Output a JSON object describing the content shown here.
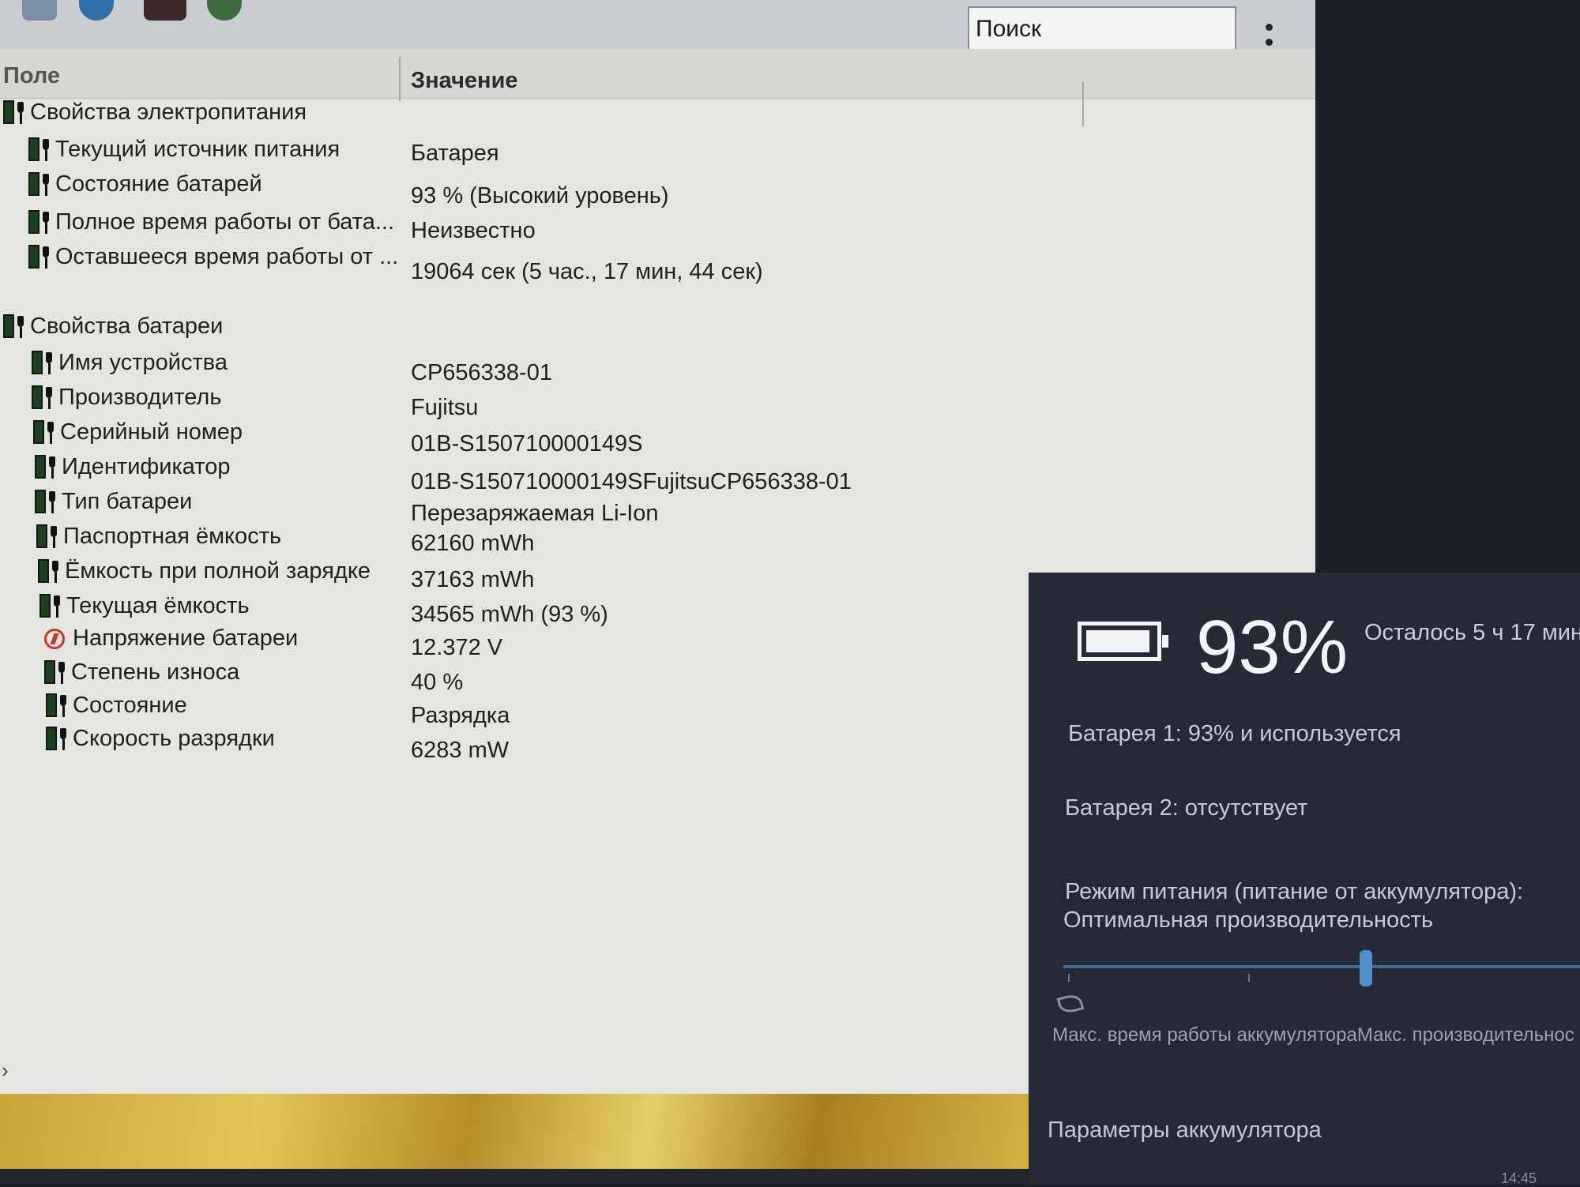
{
  "toolbar": {
    "search_value": "Поиск"
  },
  "columns": {
    "field": "Поле",
    "value": "Значение"
  },
  "power": {
    "title": "Свойства электропитания",
    "rows": [
      {
        "field": "Текущий источник питания",
        "value": "Батарея"
      },
      {
        "field": "Состояние батарей",
        "value": "93 % (Высокий уровень)"
      },
      {
        "field": "Полное время работы от бата...",
        "value": "Неизвестно"
      },
      {
        "field": "Оставшееся время работы от ...",
        "value": "19064 сек (5 час., 17 мин, 44 сек)"
      }
    ]
  },
  "battery": {
    "title": "Свойства батареи",
    "rows": [
      {
        "field": "Имя устройства",
        "value": "CP656338-01"
      },
      {
        "field": "Производитель",
        "value": "Fujitsu"
      },
      {
        "field": "Серийный номер",
        "value": "01B-S150710000149S"
      },
      {
        "field": "Идентификатор",
        "value": "01B-S150710000149SFujitsuCP656338-01"
      },
      {
        "field": "Тип батареи",
        "value": "Перезаряжаемая Li-Ion"
      },
      {
        "field": "Паспортная ёмкость",
        "value": "62160 mWh"
      },
      {
        "field": "Ёмкость при полной зарядке",
        "value": "37163 mWh"
      },
      {
        "field": "Текущая ёмкость",
        "value": "34565 mWh  (93 %)"
      },
      {
        "field": "Напряжение батареи",
        "value": "12.372 V"
      },
      {
        "field": "Степень износа",
        "value": "40 %"
      },
      {
        "field": "Состояние",
        "value": "Разрядка"
      },
      {
        "field": "Скорость разрядки",
        "value": "6283 mW"
      }
    ]
  },
  "flyout": {
    "percent": "93%",
    "remaining": "Осталось 5 ч 17 мин",
    "battery1": "Батарея 1: 93% и используется",
    "battery2": "Батарея 2: отсутствует",
    "mode_line1": "Режим питания (питание от аккумулятора):",
    "mode_line2": "Оптимальная производительность",
    "slider_min_label": "Макс. время работы аккумулятора",
    "slider_max_label": "Макс. производительнос",
    "slider_level": 0.67,
    "settings_link": "Параметры аккумулятора",
    "clock": "14:45"
  },
  "colors": {
    "window_bg": "#e4e5e0",
    "flyout_bg": "#252a36",
    "accent": "#4e8fc9",
    "battery_icon": "#1d3f1f"
  }
}
